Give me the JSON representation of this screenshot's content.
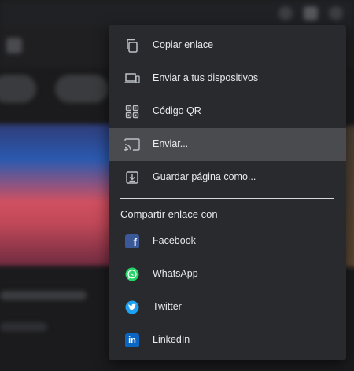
{
  "menu": {
    "actions": [
      {
        "label": "Copiar enlace",
        "icon": "copy-icon"
      },
      {
        "label": "Enviar a tus dispositivos",
        "icon": "send-to-devices-icon"
      },
      {
        "label": "Código QR",
        "icon": "qr-code-icon"
      },
      {
        "label": "Enviar...",
        "icon": "cast-icon",
        "highlighted": true
      },
      {
        "label": "Guardar página como...",
        "icon": "save-page-icon"
      }
    ],
    "share_section_title": "Compartir enlace con",
    "share_targets": [
      {
        "label": "Facebook",
        "icon": "facebook-icon",
        "color": "#3b5998"
      },
      {
        "label": "WhatsApp",
        "icon": "whatsapp-icon",
        "color": "#25d366"
      },
      {
        "label": "Twitter",
        "icon": "twitter-icon",
        "color": "#1da1f2"
      },
      {
        "label": "LinkedIn",
        "icon": "linkedin-icon",
        "color": "#0a66c2"
      }
    ]
  },
  "colors": {
    "menu_background": "#292a2d",
    "highlight": "#4a4b4f",
    "text": "#e8eaed"
  }
}
